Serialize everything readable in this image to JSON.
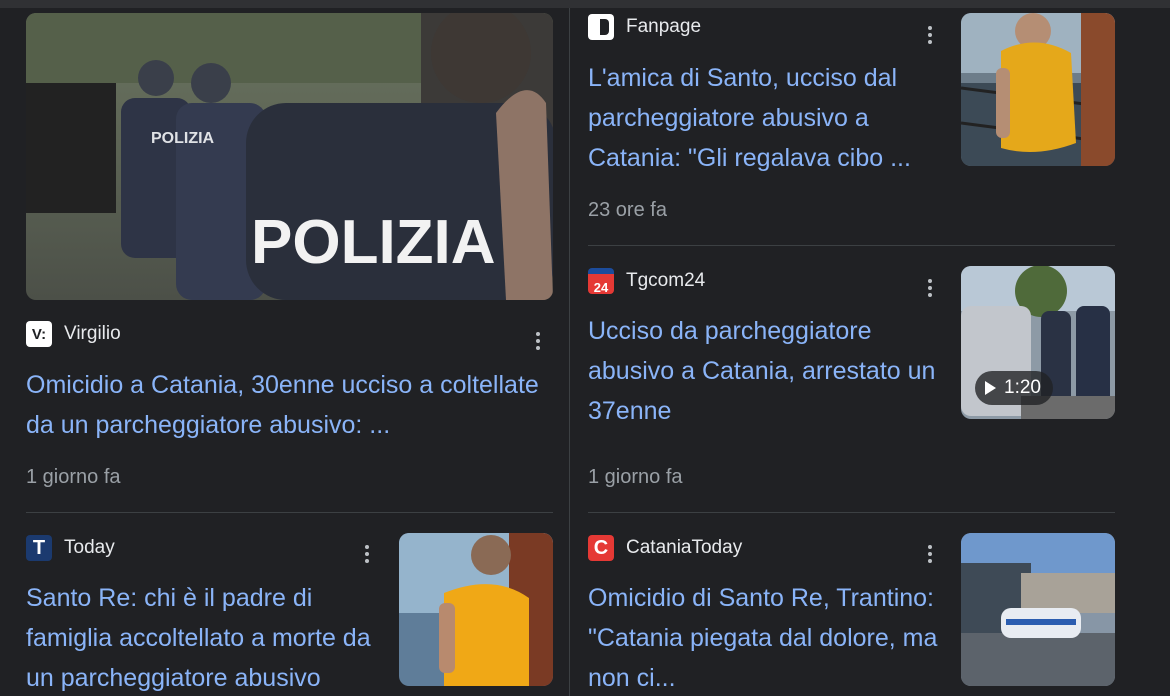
{
  "articles": [
    {
      "source": "Virgilio",
      "logo_text": "V:",
      "headline": "Omicidio a Catania, 30enne ucciso a coltellate da un parcheggiatore abusivo: ...",
      "time": "1 giorno fa",
      "thumb_text": "POLIZIA",
      "thumb_text_small": "POLIZIA"
    },
    {
      "source": "Fanpage",
      "logo_text": "",
      "headline": "L'amica di Santo, ucciso dal parcheggiatore abusivo a Catania: \"Gli regalava cibo ...",
      "time": "23 ore fa"
    },
    {
      "source": "Tgcom24",
      "logo_text": "24",
      "headline": "Ucciso da parcheggiatore abusivo a Catania, arrestato un 37enne",
      "time": "1 giorno fa",
      "video_duration": "1:20"
    },
    {
      "source": "Today",
      "logo_text": "T",
      "headline": "Santo Re: chi è il padre di famiglia accoltellato a morte da un parcheggiatore abusivo"
    },
    {
      "source": "CataniaToday",
      "logo_text": "C",
      "headline": "Omicidio di Santo Re, Trantino: \"Catania piegata dal dolore, ma non ci..."
    }
  ],
  "colors": {
    "background": "#202124",
    "link": "#8ab4f8",
    "meta": "#9aa0a6",
    "divider": "#3c4043"
  },
  "icons": {
    "more": "more-vert-icon",
    "play": "play-icon"
  }
}
